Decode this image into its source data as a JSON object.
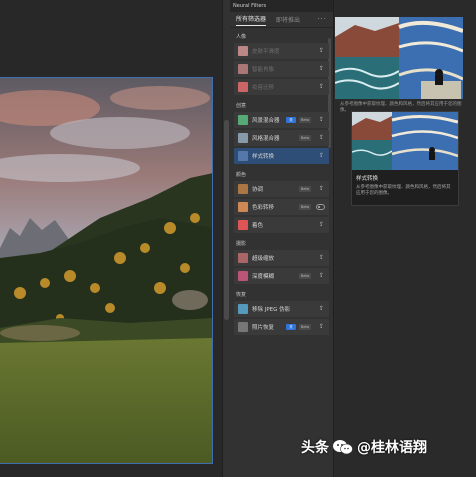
{
  "window": {
    "title": "Neural Filters"
  },
  "tabs": [
    {
      "label": "所有筛选器",
      "active": true
    },
    {
      "label": "即将推出",
      "active": false
    }
  ],
  "sections": [
    {
      "title": "人像",
      "items": [
        {
          "label": "皮肤平滑度",
          "dim": true,
          "thumb": "#b88",
          "cloud": true
        },
        {
          "label": "智能肖像",
          "dim": true,
          "thumb": "#a77",
          "cloud": true
        },
        {
          "label": "妆容迁移",
          "dim": true,
          "thumb": "#c66",
          "cloud": true
        }
      ]
    },
    {
      "title": "创意",
      "items": [
        {
          "label": "风景混合器",
          "thumb": "#5a7",
          "on": "关",
          "beta": "Beta",
          "cloud": true
        },
        {
          "label": "风格混合器",
          "thumb": "#89a",
          "beta": "Beta",
          "cloud": true
        },
        {
          "label": "样式转换",
          "thumb": "#57a",
          "selected": true,
          "cloud": true
        }
      ]
    },
    {
      "title": "颜色",
      "items": [
        {
          "label": "协调",
          "thumb": "#a74",
          "beta": "Beta",
          "cloud": true
        },
        {
          "label": "色彩转移",
          "thumb": "#c85",
          "beta": "Beta",
          "toggle": true
        },
        {
          "label": "着色",
          "thumb": "#d55",
          "cloud": true
        }
      ]
    },
    {
      "title": "摄影",
      "items": [
        {
          "label": "超级缩放",
          "thumb": "#a66",
          "cloud": true
        },
        {
          "label": "深度模糊",
          "thumb": "#b57",
          "beta": "Beta",
          "cloud": true
        }
      ]
    },
    {
      "title": "恢复",
      "items": [
        {
          "label": "移除 JPEG 伪影",
          "thumb": "#59b",
          "cloud": true
        },
        {
          "label": "照片恢复",
          "thumb": "#777",
          "on": "关",
          "beta": "Beta",
          "cloud": true
        }
      ]
    }
  ],
  "preview": {
    "hint": "从参考图像中获取纹理、颜色和风格，然后将其应用于您的图像。",
    "tooltip_title": "样式转换",
    "tooltip_desc": "从参考图像中获取纹理、颜色和风格，然后将其应用于您的图像。"
  },
  "watermark": {
    "prefix": "头条",
    "name": "@桂林语翔"
  },
  "icons": {
    "more": "more-dots-icon",
    "cloud": "cloud-icon"
  }
}
